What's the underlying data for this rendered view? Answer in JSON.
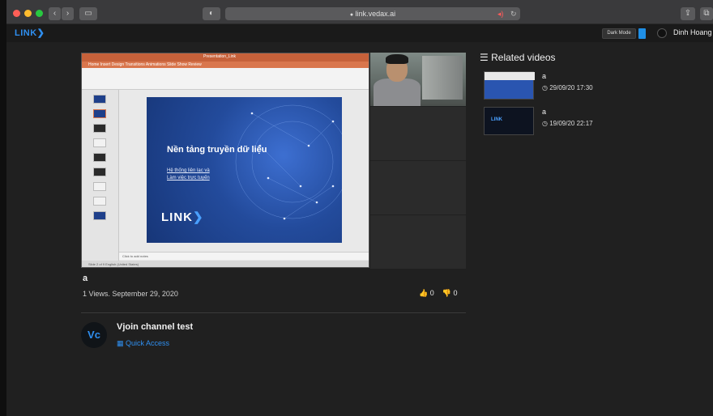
{
  "browser": {
    "url": "link.vedax.ai",
    "nav_back": "‹",
    "nav_forward": "›",
    "sidebar_btn": "▭",
    "shield": "◐",
    "share": "⇪",
    "tabs": "⧉",
    "audio": "◂)",
    "reload": "↻",
    "lock": "🔒"
  },
  "header": {
    "logo": "LINK",
    "dark_mode_label": "Dark Mode",
    "user_name": "Dinh Hoang"
  },
  "slide": {
    "title": "Nền tảng truyền dữ liệu",
    "subtitle_line1": "Hệ thống liên lạc và",
    "subtitle_line2": "Làm việc trực tuyến",
    "logo": "LINK",
    "notes": "Click to add notes",
    "ppt_title": "Presentation_Link",
    "ppt_tabs": "Home   Insert   Design   Transitions   Animations   Slide Show   Review",
    "status": "Slide 2 of 9     English (United States)"
  },
  "video": {
    "title": "a",
    "meta": "1 Views. September 29, 2020",
    "likes": "0",
    "dislikes": "0"
  },
  "channel": {
    "avatar_initials": "Vc",
    "name": "Vjoin channel test",
    "quick_access": "Quick Access"
  },
  "related": {
    "heading": "Related videos",
    "items": [
      {
        "title": "a",
        "date": "29/09/20 17:30"
      },
      {
        "title": "a",
        "date": "19/09/20 22:17"
      }
    ],
    "thumb2_text": "LINK"
  },
  "colors": {
    "accent": "#2f8ff0",
    "toggle": "#1f8fe6",
    "background": "#202020"
  }
}
